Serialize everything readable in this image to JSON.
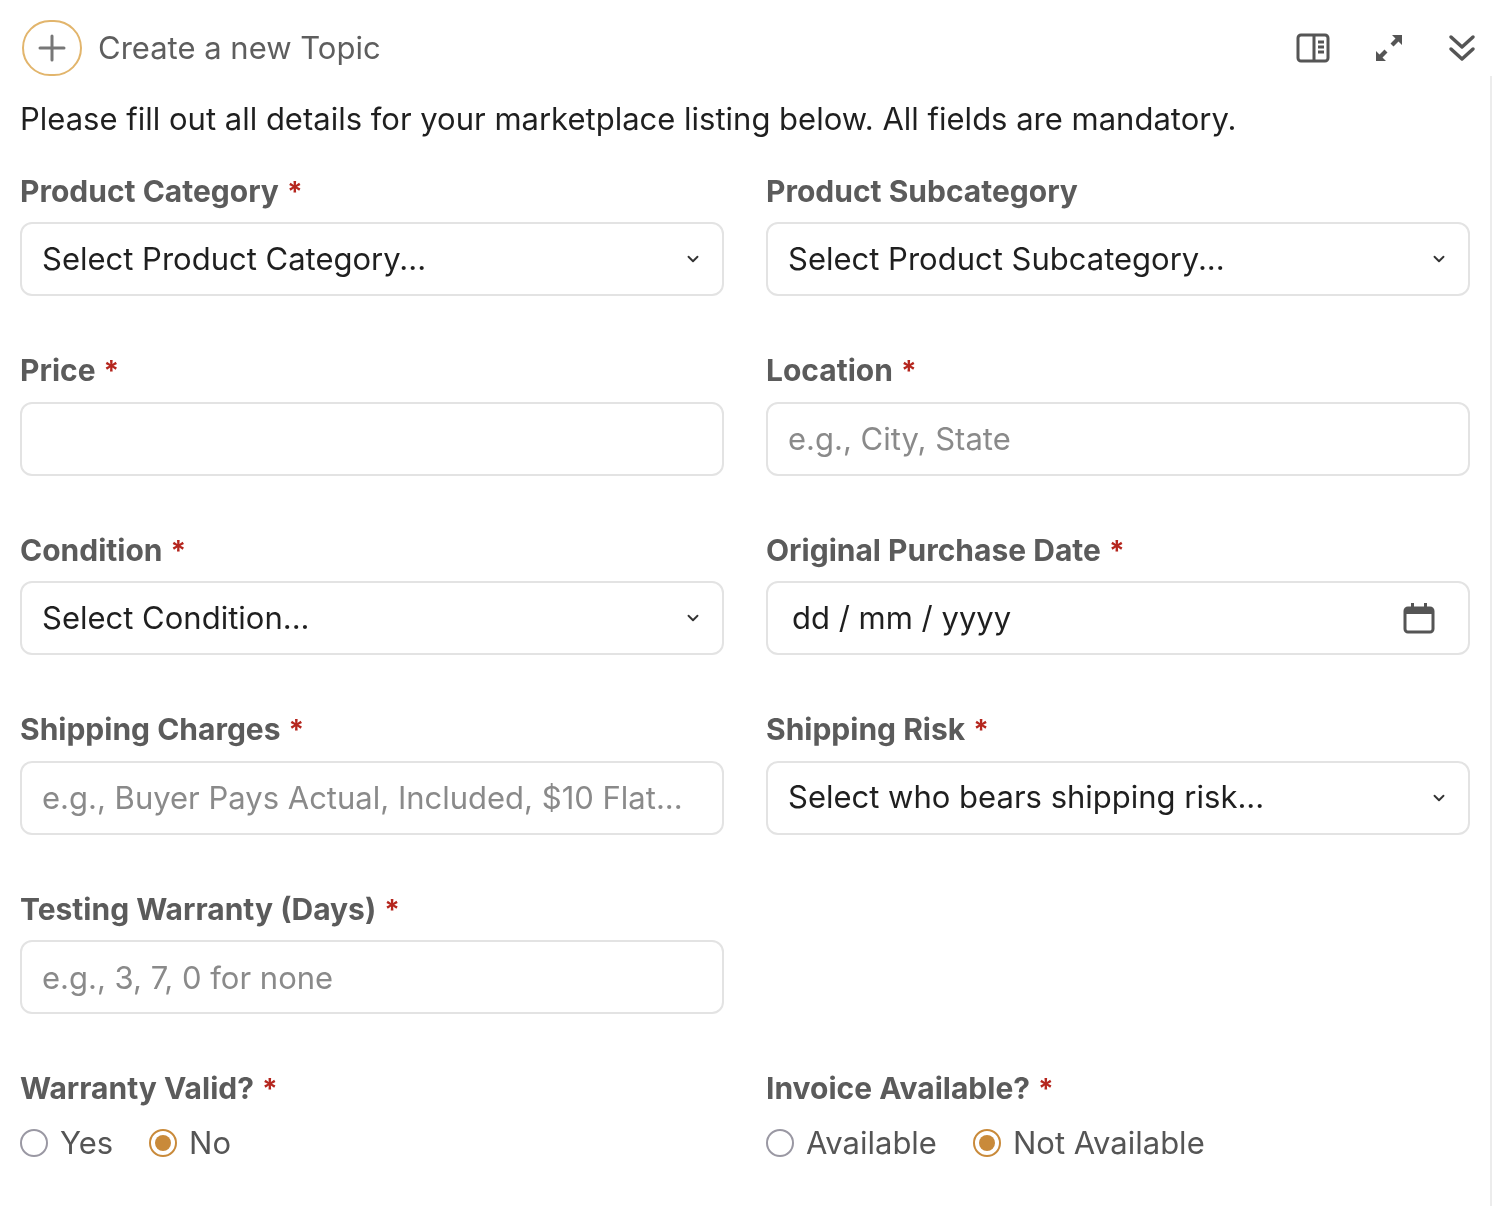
{
  "header": {
    "title": "Create a new Topic"
  },
  "intro": "Please fill out all details for your marketplace listing below. All fields are mandatory.",
  "rows": [
    [
      {
        "kind": "select",
        "label": "Product Category",
        "required_mark": "*",
        "value": "Select Product Category..."
      },
      {
        "kind": "select",
        "label": "Product Subcategory",
        "value": "Select Product Subcategory..."
      }
    ],
    [
      {
        "kind": "text",
        "label": "Price",
        "required_mark": "*"
      },
      {
        "kind": "text",
        "label": "Location",
        "required_mark": "*",
        "placeholder": "e.g., City, State"
      }
    ],
    [
      {
        "kind": "select",
        "label": "Condition",
        "required_mark": "*",
        "value": "Select Condition..."
      },
      {
        "kind": "date",
        "label": "Original Purchase Date",
        "required_mark": "*",
        "value": "dd / mm / yyyy"
      }
    ],
    [
      {
        "kind": "text",
        "label": "Shipping Charges",
        "required_mark": "*",
        "placeholder": "e.g., Buyer Pays Actual, Included, $10 Flat..."
      },
      {
        "kind": "select",
        "label": "Shipping Risk",
        "required_mark": "*",
        "value": "Select who bears shipping risk..."
      }
    ],
    [
      {
        "kind": "text",
        "label": "Testing Warranty (Days)",
        "required_mark": "*",
        "placeholder": "e.g., 3, 7, 0 for none"
      }
    ],
    [
      {
        "kind": "radio",
        "label": "Warranty Valid?",
        "required_mark": "*",
        "options": [
          {
            "label": "Yes",
            "selected": false
          },
          {
            "label": "No",
            "selected": true
          }
        ]
      },
      {
        "kind": "radio",
        "label": "Invoice Available?",
        "required_mark": "*",
        "options": [
          {
            "label": "Available",
            "selected": false
          },
          {
            "label": "Not Available",
            "selected": true
          }
        ]
      }
    ]
  ]
}
